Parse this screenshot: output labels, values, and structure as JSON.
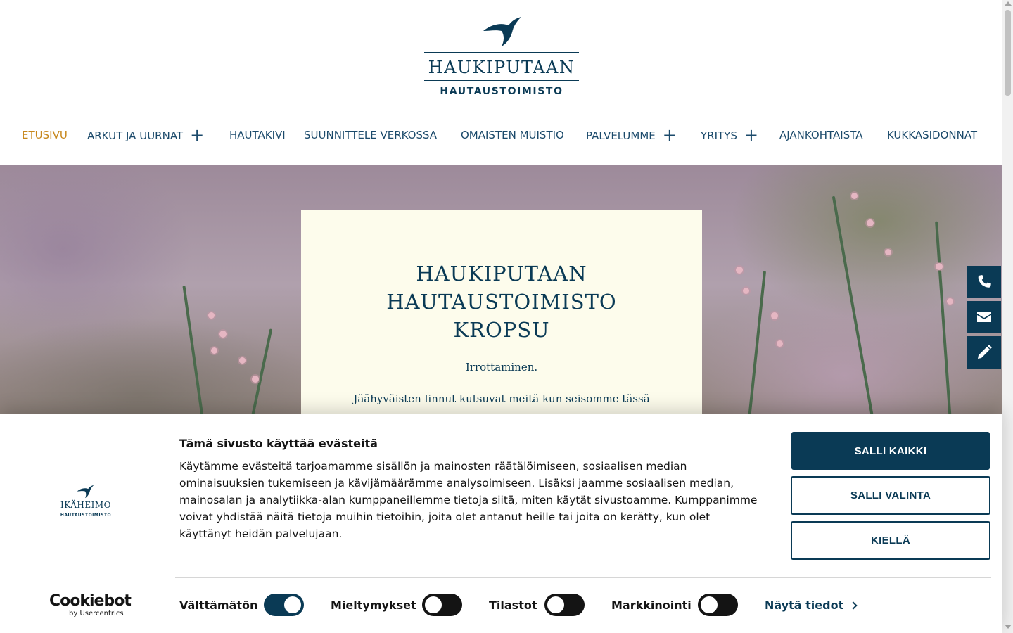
{
  "site": {
    "logo_name": "HAUKIPUTAAN",
    "logo_sub": "HAUTAUSTOIMISTO"
  },
  "nav": {
    "items": [
      {
        "label": "ETUSIVU",
        "active": true,
        "has_submenu": false
      },
      {
        "label": "ARKUT JA UURNAT",
        "active": false,
        "has_submenu": true
      },
      {
        "label": "HAUTAKIVI",
        "active": false,
        "has_submenu": false
      },
      {
        "label": "SUUNNITTELE VERKOSSA",
        "active": false,
        "has_submenu": false
      },
      {
        "label": "OMAISTEN MUISTIO",
        "active": false,
        "has_submenu": false
      },
      {
        "label": "PALVELUMME",
        "active": false,
        "has_submenu": true
      },
      {
        "label": "YRITYS",
        "active": false,
        "has_submenu": true
      },
      {
        "label": "AJANKOHTAISTA",
        "active": false,
        "has_submenu": false
      },
      {
        "label": "KUKKASIDONNAT",
        "active": false,
        "has_submenu": false
      }
    ],
    "submenu_icon": "plus-icon",
    "active_color": "#c7871c",
    "color": "#1b4a6b"
  },
  "hero": {
    "title_lines": [
      "HAUKIPUTAAN",
      "HAUTAUSTOIMISTO",
      "KROPSU"
    ],
    "line1": "Irrottaminen.",
    "line2": "Jäähyväisten linnut kutsuvat meitä kun seisomme tässä"
  },
  "side_buttons": [
    {
      "icon": "phone-icon"
    },
    {
      "icon": "envelope-icon"
    },
    {
      "icon": "pencil-icon"
    }
  ],
  "cookie": {
    "logo_name": "IKÄHEIMO",
    "logo_sub": "HAUTAUSTOIMISTO",
    "title": "Tämä sivusto käyttää evästeitä",
    "body": "Käytämme evästeitä tarjoamamme sisällön ja mainosten räätälöimiseen, sosiaalisen median ominaisuuksien tukemiseen ja kävijämäärämme analysoimiseen. Lisäksi jaamme sosiaalisen median, mainosalan ja analytiikka-alan kumppaneillemme tietoja siitä, miten käytät sivustoamme. Kumppanimme voivat yhdistää näitä tietoja muihin tietoihin, joita olet antanut heille tai joita on kerätty, kun olet käyttänyt heidän palvelujaan.",
    "allow_all": "SALLI KAIKKI",
    "allow_selection": "SALLI VALINTA",
    "deny": "KIELLÄ",
    "brand_main": "Cookiebot",
    "brand_sub": "by Usercentrics",
    "toggles": [
      {
        "label": "Välttämätön",
        "on": true
      },
      {
        "label": "Mieltymykset",
        "on": false
      },
      {
        "label": "Tilastot",
        "on": false
      },
      {
        "label": "Markkinointi",
        "on": false
      }
    ],
    "details": "Näytä tiedot"
  },
  "colors": {
    "brand": "#0a3a55",
    "card_bg": "#fdfcec"
  }
}
